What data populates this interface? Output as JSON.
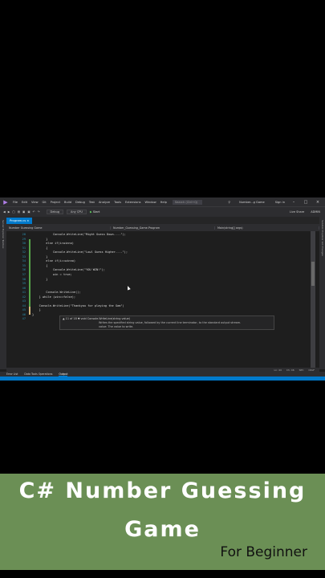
{
  "menubar": {
    "items": [
      "File",
      "Edit",
      "View",
      "Git",
      "Project",
      "Build",
      "Debug",
      "Test",
      "Analyze",
      "Tools",
      "Extensions",
      "Window",
      "Help"
    ],
    "search_placeholder": "Search (Ctrl+Q)",
    "window_title": "Number...g Game",
    "signin": "Sign in"
  },
  "toolbar": {
    "config": "Debug",
    "platform": "Any CPU",
    "start_label": "Start",
    "live_share": "Live Share",
    "admin": "ADMIN"
  },
  "tabs": {
    "active": "Program.cs"
  },
  "navbar": {
    "project": "Number Guessing Game",
    "class": "Number_Guessing_Game.Program",
    "member": "Main(string[] args)"
  },
  "side": {
    "left": "Server Explorer  Toolbox",
    "right": "Solution Explorer  Git Changes"
  },
  "code": {
    "lines": [
      {
        "n": "28",
        "t": "            Console.WriteLine(\"Might Guess Down....\");"
      },
      {
        "n": "29",
        "t": "        }"
      },
      {
        "n": "30",
        "t": "        else if(i>winno)"
      },
      {
        "n": "31",
        "t": "        {"
      },
      {
        "n": "32",
        "t": "            Console.WriteLine(\"Lowl Guess Higher....\");"
      },
      {
        "n": "33",
        "t": "        }"
      },
      {
        "n": "34",
        "t": "        else if(i==winno)"
      },
      {
        "n": "35",
        "t": "        {"
      },
      {
        "n": "36",
        "t": "            Console.WriteLine(\"YOU WIN!\");"
      },
      {
        "n": "37",
        "t": "            win = true;"
      },
      {
        "n": "38",
        "t": "        }"
      },
      {
        "n": "39",
        "t": ""
      },
      {
        "n": "40",
        "t": ""
      },
      {
        "n": "41",
        "t": "        Console.WriteLine();"
      },
      {
        "n": "42",
        "t": "    } while (win==false);"
      },
      {
        "n": "43",
        "t": ""
      },
      {
        "n": "44",
        "t": "    Console.WriteLine(\"Thankyou for playing the Gam\")"
      },
      {
        "n": "45",
        "t": "    }"
      },
      {
        "n": "46",
        "t": "}"
      },
      {
        "n": "47",
        "t": ""
      }
    ]
  },
  "tooltip": {
    "line1": "▲ 11 of 18 ▼  void Console.WriteLine(string value)",
    "line2": "Writes the specified string value, followed by the current line terminator, to the standard output stream.",
    "line3": "value: The value to write."
  },
  "status": {
    "zoom": "Ln: 44",
    "ch": "Ch: 46",
    "spc": "SPC",
    "crlf": "CRLF"
  },
  "bottom_tabs": [
    "Error List",
    "Data Tools Operations",
    "Output"
  ],
  "banner": {
    "line1": "C# Number Guessing",
    "line2": "Game",
    "sub": "For Beginner"
  }
}
